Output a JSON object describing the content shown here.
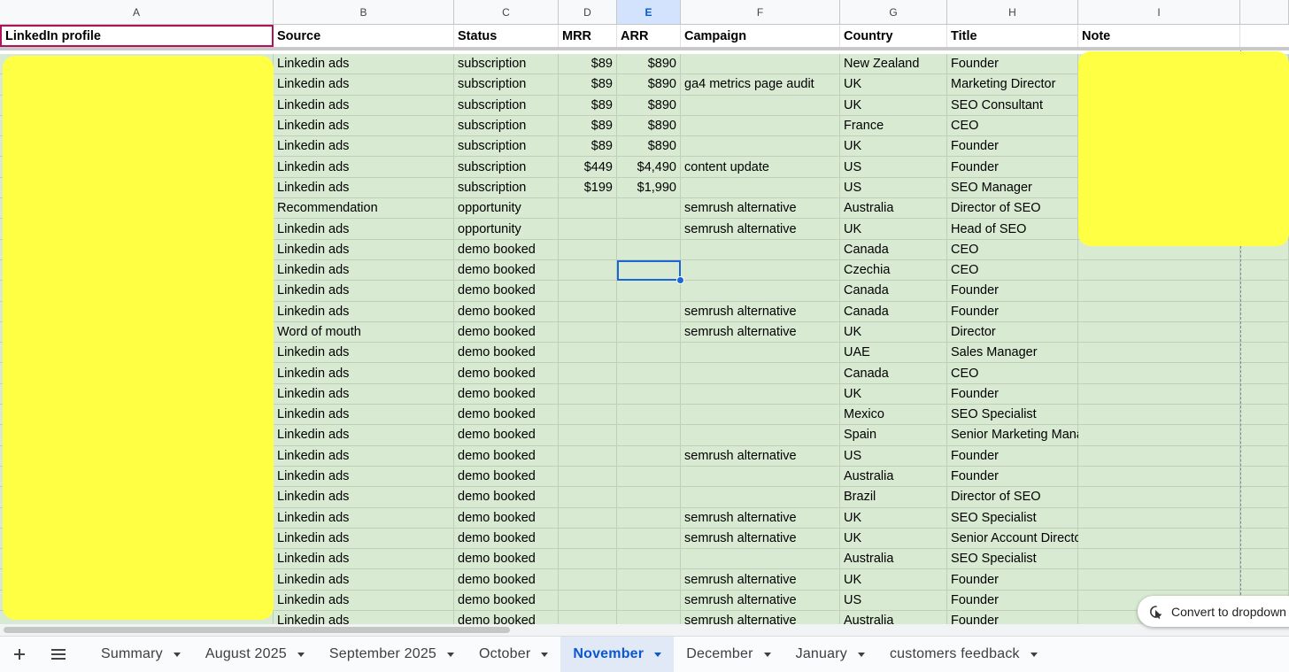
{
  "columns": [
    "A",
    "B",
    "C",
    "D",
    "E",
    "F",
    "G",
    "H",
    "I"
  ],
  "active_column": "E",
  "headers": [
    "LinkedIn profile",
    "Source",
    "Status",
    "MRR",
    "ARR",
    "Campaign",
    "Country",
    "Title",
    "Note"
  ],
  "rows": [
    [
      "",
      "Linkedin ads",
      "subscription",
      "$89",
      "$890",
      "",
      "New Zealand",
      "Founder",
      ""
    ],
    [
      "",
      "Linkedin ads",
      "subscription",
      "$89",
      "$890",
      "ga4 metrics page audit",
      "UK",
      "Marketing Director",
      ""
    ],
    [
      "",
      "Linkedin ads",
      "subscription",
      "$89",
      "$890",
      "",
      "UK",
      "SEO Consultant",
      ""
    ],
    [
      "",
      "Linkedin ads",
      "subscription",
      "$89",
      "$890",
      "",
      "France",
      "CEO",
      ""
    ],
    [
      "",
      "Linkedin ads",
      "subscription",
      "$89",
      "$890",
      "",
      "UK",
      "Founder",
      ""
    ],
    [
      "",
      "Linkedin ads",
      "subscription",
      "$449",
      "$4,490",
      "content update",
      "US",
      "Founder",
      ""
    ],
    [
      "",
      "Linkedin ads",
      "subscription",
      "$199",
      "$1,990",
      "",
      "US",
      "SEO Manager",
      ""
    ],
    [
      "",
      "Recommendation",
      "opportunity",
      "",
      "",
      "semrush alternative",
      "Australia",
      "Director of SEO",
      ""
    ],
    [
      "",
      "Linkedin ads",
      "opportunity",
      "",
      "",
      "semrush alternative",
      "UK",
      "Head of SEO",
      ""
    ],
    [
      "",
      "Linkedin ads",
      "demo booked",
      "",
      "",
      "",
      "Canada",
      "CEO",
      ""
    ],
    [
      "",
      "Linkedin ads",
      "demo booked",
      "",
      "",
      "",
      "Czechia",
      "CEO",
      ""
    ],
    [
      "",
      "Linkedin ads",
      "demo booked",
      "",
      "",
      "",
      "Canada",
      "Founder",
      ""
    ],
    [
      "",
      "Linkedin ads",
      "demo booked",
      "",
      "",
      "semrush alternative",
      "Canada",
      "Founder",
      ""
    ],
    [
      "",
      "Word of mouth",
      "demo booked",
      "",
      "",
      "semrush alternative",
      "UK",
      "Director",
      ""
    ],
    [
      "",
      "Linkedin ads",
      "demo booked",
      "",
      "",
      "",
      "UAE",
      "Sales Manager",
      ""
    ],
    [
      "",
      "Linkedin ads",
      "demo booked",
      "",
      "",
      "",
      "Canada",
      "CEO",
      ""
    ],
    [
      "",
      "Linkedin ads",
      "demo booked",
      "",
      "",
      "",
      "UK",
      "Founder",
      ""
    ],
    [
      "",
      "Linkedin ads",
      "demo booked",
      "",
      "",
      "",
      "Mexico",
      "SEO Specialist",
      ""
    ],
    [
      "",
      "Linkedin ads",
      "demo booked",
      "",
      "",
      "",
      "Spain",
      "Senior Marketing Manager",
      ""
    ],
    [
      "",
      "Linkedin ads",
      "demo booked",
      "",
      "",
      "semrush alternative",
      "US",
      "Founder",
      ""
    ],
    [
      "",
      "Linkedin ads",
      "demo booked",
      "",
      "",
      "",
      "Australia",
      "Founder",
      ""
    ],
    [
      "",
      "Linkedin ads",
      "demo booked",
      "",
      "",
      "",
      "Brazil",
      "Director of SEO",
      ""
    ],
    [
      "",
      "Linkedin ads",
      "demo booked",
      "",
      "",
      "semrush alternative",
      "UK",
      "SEO Specialist",
      ""
    ],
    [
      "",
      "Linkedin ads",
      "demo booked",
      "",
      "",
      "semrush alternative",
      "UK",
      "Senior Account Director",
      ""
    ],
    [
      "",
      "Linkedin ads",
      "demo booked",
      "",
      "",
      "",
      "Australia",
      "SEO Specialist",
      ""
    ],
    [
      "",
      "Linkedin ads",
      "demo booked",
      "",
      "",
      "semrush alternative",
      "UK",
      "Founder",
      ""
    ],
    [
      "",
      "Linkedin ads",
      "demo booked",
      "",
      "",
      "semrush alternative",
      "US",
      "Founder",
      ""
    ],
    [
      "",
      "Linkedin ads",
      "demo booked",
      "",
      "",
      "semrush alternative",
      "Australia",
      "Founder",
      ""
    ]
  ],
  "selected_cell": {
    "row": 10,
    "column": "E"
  },
  "convert_chip": {
    "label": "Convert to dropdown",
    "icon": "cursor-click-icon"
  },
  "tabs": {
    "add_icon": "plus-icon",
    "menu_icon": "all-sheets-menu-icon",
    "items": [
      "Summary",
      "August 2025",
      "September 2025",
      "October",
      "November",
      "December",
      "January",
      "customers feedback"
    ],
    "active": "November"
  },
  "colors": {
    "row_fill": "#d9ead3",
    "selection": "#1a66d6",
    "header_select": "#b0125c",
    "redaction": "#ffff44",
    "active_tab": "#0b57d0"
  }
}
